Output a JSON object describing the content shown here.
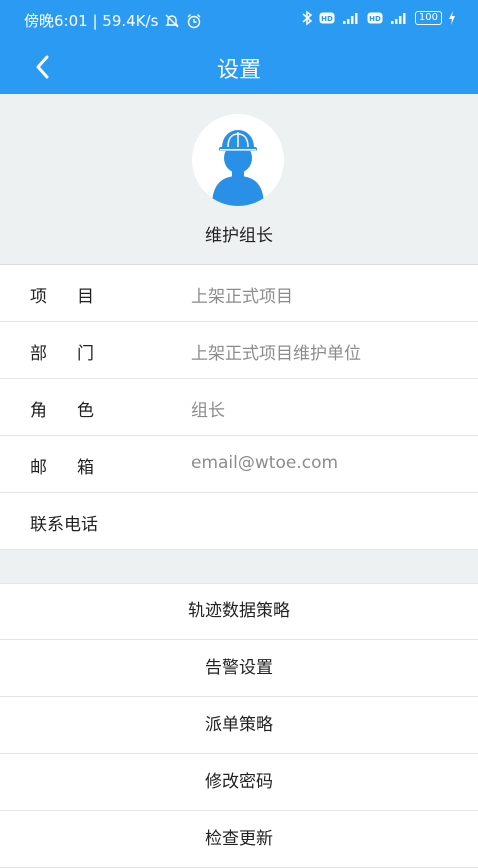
{
  "status_bar": {
    "left_text": "傍晚6:01 | 59.4K/s",
    "battery": "100",
    "icons": [
      "mute-icon",
      "alarm-icon",
      "bluetooth-icon",
      "hd-icon",
      "signal-icon",
      "hd-icon",
      "signal-icon",
      "battery-icon",
      "charging-icon"
    ]
  },
  "header": {
    "title": "设置"
  },
  "profile": {
    "name": "维护组长"
  },
  "info": {
    "rows": [
      {
        "label": "项目",
        "value": "上架正式项目"
      },
      {
        "label": "部门",
        "value": "上架正式项目维护单位"
      },
      {
        "label": "角色",
        "value": "组长"
      },
      {
        "label": "邮箱",
        "value": "email@wtoe.com"
      },
      {
        "label": "联系电话",
        "value": ""
      }
    ]
  },
  "menu": {
    "items": [
      {
        "label": "轨迹数据策略"
      },
      {
        "label": "告警设置"
      },
      {
        "label": "派单策略"
      },
      {
        "label": "修改密码"
      },
      {
        "label": "检查更新"
      }
    ]
  },
  "colors": {
    "accent": "#2b9af3",
    "avatar": "#2a8fe6",
    "background": "#eef1f1"
  }
}
